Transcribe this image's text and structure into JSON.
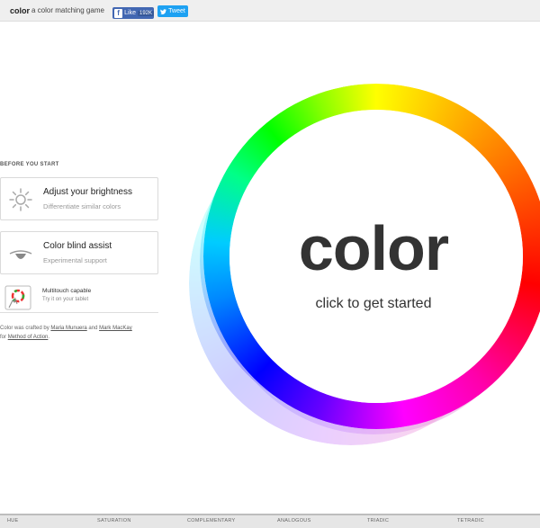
{
  "header": {
    "brand": "color",
    "tagline": "a color matching game",
    "like_label": "Like",
    "like_count": "192K",
    "tweet_label": "Tweet"
  },
  "sidebar": {
    "section_label": "BEFORE YOU START",
    "cards": [
      {
        "title": "Adjust your brightness",
        "subtitle": "Differentiate similar colors",
        "icon": "sun-icon"
      },
      {
        "title": "Color blind assist",
        "subtitle": "Experimental support",
        "icon": "eye-icon"
      }
    ],
    "multitouch": {
      "title": "Multitouch capable",
      "subtitle": "Try it on your tablet",
      "icon": "tablet-icon"
    },
    "credits": {
      "prefix": "Color was crafted by",
      "author1": "Maria Munuera",
      "and": "and",
      "author2": "Mark MacKay",
      "for": "for",
      "org": "Method of Action",
      "suffix": "."
    }
  },
  "main": {
    "title": "color",
    "cta": "click to get started"
  },
  "nav": {
    "items": [
      "HUE",
      "SATURATION",
      "COMPLEMENTARY",
      "ANALOGOUS",
      "TRIADIC",
      "TETRADIC"
    ]
  }
}
